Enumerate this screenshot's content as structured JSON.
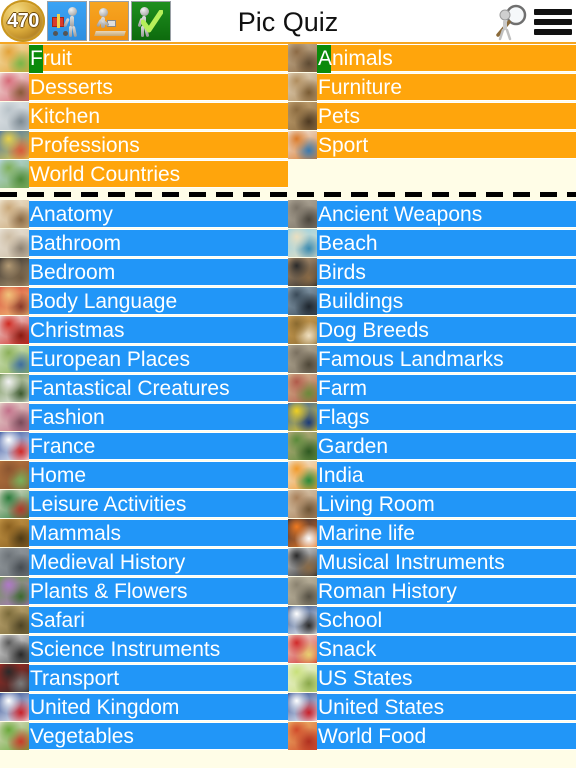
{
  "header": {
    "coin_count": "470",
    "title": "Pic Quiz",
    "icons": [
      {
        "name": "shopping-cart-icon",
        "label": "Shop"
      },
      {
        "name": "desk-worker-icon",
        "label": "Office"
      },
      {
        "name": "check-mark-icon",
        "label": "Correct"
      }
    ],
    "search_icon_label": "Search",
    "menu_icon_label": "Menu",
    "accent_color": "#F5A623"
  },
  "colors": {
    "page_background": "#FFFDE7",
    "unlocked_row": "#FFA50C",
    "locked_row": "#2196F8",
    "selection_marker": "#0A8A0A",
    "label_text": "#FFFFFF"
  },
  "sections": [
    {
      "id": "featured",
      "row_color": "#FFA50C",
      "left_column": [
        {
          "label": "Fruit",
          "thumb": "fruit-bowl-thumb",
          "selected": true
        },
        {
          "label": "Desserts",
          "thumb": "layer-cake-thumb",
          "selected": false
        },
        {
          "label": "Kitchen",
          "thumb": "kitchen-interior-thumb",
          "selected": false
        },
        {
          "label": "Professions",
          "thumb": "workers-group-thumb",
          "selected": false
        },
        {
          "label": "World Countries",
          "thumb": "world-map-thumb",
          "selected": false
        }
      ],
      "right_column": [
        {
          "label": "Animals",
          "thumb": "animals-collage-thumb",
          "selected": true
        },
        {
          "label": "Furniture",
          "thumb": "armchair-thumb",
          "selected": false
        },
        {
          "label": "Pets",
          "thumb": "tabby-cat-thumb",
          "selected": false
        },
        {
          "label": "Sport",
          "thumb": "sports-collage-thumb",
          "selected": false
        }
      ]
    },
    {
      "id": "all-categories",
      "row_color": "#2196F8",
      "left_column": [
        {
          "label": "Anatomy",
          "thumb": "human-body-thumb"
        },
        {
          "label": "Bathroom",
          "thumb": "bathroom-thumb"
        },
        {
          "label": "Bedroom",
          "thumb": "bedroom-thumb"
        },
        {
          "label": "Body Language",
          "thumb": "faces-thumb"
        },
        {
          "label": "Christmas",
          "thumb": "santa-thumb"
        },
        {
          "label": "European Places",
          "thumb": "europe-map-thumb"
        },
        {
          "label": "Fantastical Creatures",
          "thumb": "unicorn-thumb"
        },
        {
          "label": "Fashion",
          "thumb": "fashion-model-thumb"
        },
        {
          "label": "France",
          "thumb": "french-flag-thumb"
        },
        {
          "label": "Home",
          "thumb": "house-thumb"
        },
        {
          "label": "Leisure Activities",
          "thumb": "leisure-thumb"
        },
        {
          "label": "Mammals",
          "thumb": "lion-thumb"
        },
        {
          "label": "Medieval History",
          "thumb": "castle-thumb"
        },
        {
          "label": "Plants & Flowers",
          "thumb": "flowers-thumb"
        },
        {
          "label": "Safari",
          "thumb": "safari-animals-thumb"
        },
        {
          "label": "Science Instruments",
          "thumb": "microscope-thumb"
        },
        {
          "label": "Transport",
          "thumb": "vehicles-thumb"
        },
        {
          "label": "United Kingdom",
          "thumb": "union-jack-thumb"
        },
        {
          "label": "Vegetables",
          "thumb": "vegetables-thumb"
        }
      ],
      "right_column": [
        {
          "label": "Ancient Weapons",
          "thumb": "ancient-weapons-thumb"
        },
        {
          "label": "Beach",
          "thumb": "beach-thumb"
        },
        {
          "label": "Birds",
          "thumb": "bird-thumb"
        },
        {
          "label": "Buildings",
          "thumb": "skyscrapers-thumb"
        },
        {
          "label": "Dog Breeds",
          "thumb": "golden-retriever-thumb"
        },
        {
          "label": "Famous Landmarks",
          "thumb": "landmark-thumb"
        },
        {
          "label": "Farm",
          "thumb": "farm-thumb"
        },
        {
          "label": "Flags",
          "thumb": "flag-thumb"
        },
        {
          "label": "Garden",
          "thumb": "garden-thumb"
        },
        {
          "label": "India",
          "thumb": "india-map-thumb"
        },
        {
          "label": "Living Room",
          "thumb": "living-room-thumb"
        },
        {
          "label": "Marine life",
          "thumb": "clownfish-thumb"
        },
        {
          "label": "Musical Instruments",
          "thumb": "piano-thumb"
        },
        {
          "label": "Roman History",
          "thumb": "roman-ruins-thumb"
        },
        {
          "label": "School",
          "thumb": "backpack-thumb"
        },
        {
          "label": "Snack",
          "thumb": "popcorn-thumb"
        },
        {
          "label": "US States",
          "thumb": "us-states-map-thumb"
        },
        {
          "label": "United States",
          "thumb": "us-flag-map-thumb"
        },
        {
          "label": "World Food",
          "thumb": "pizza-thumb"
        }
      ]
    }
  ]
}
